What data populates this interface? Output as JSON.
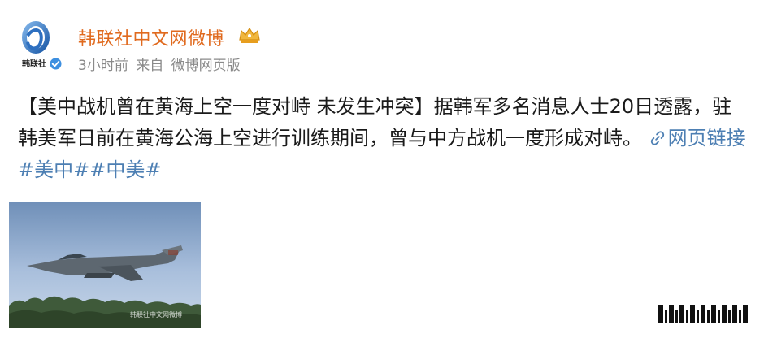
{
  "header": {
    "username": "韩联社中文网微博",
    "avatar_label": "韩联社",
    "time": "3小时前",
    "source_prefix": "来自",
    "source": "微博网页版"
  },
  "post": {
    "headline": "【美中战机曾在黄海上空一度对峙 未发生冲突】",
    "body": "据韩军多名消息人士20日透露，驻韩美军日前在黄海公海上空进行训练期间，曾与中方战机一度形成对峙。",
    "link_label": "网页链接",
    "tags": [
      "#美中#",
      "#中美#"
    ]
  },
  "image": {
    "watermark": "韩联社中文网微博"
  },
  "colors": {
    "username": "#e06a1e",
    "link": "#4d7fb3",
    "meta": "#8a8a8a"
  }
}
